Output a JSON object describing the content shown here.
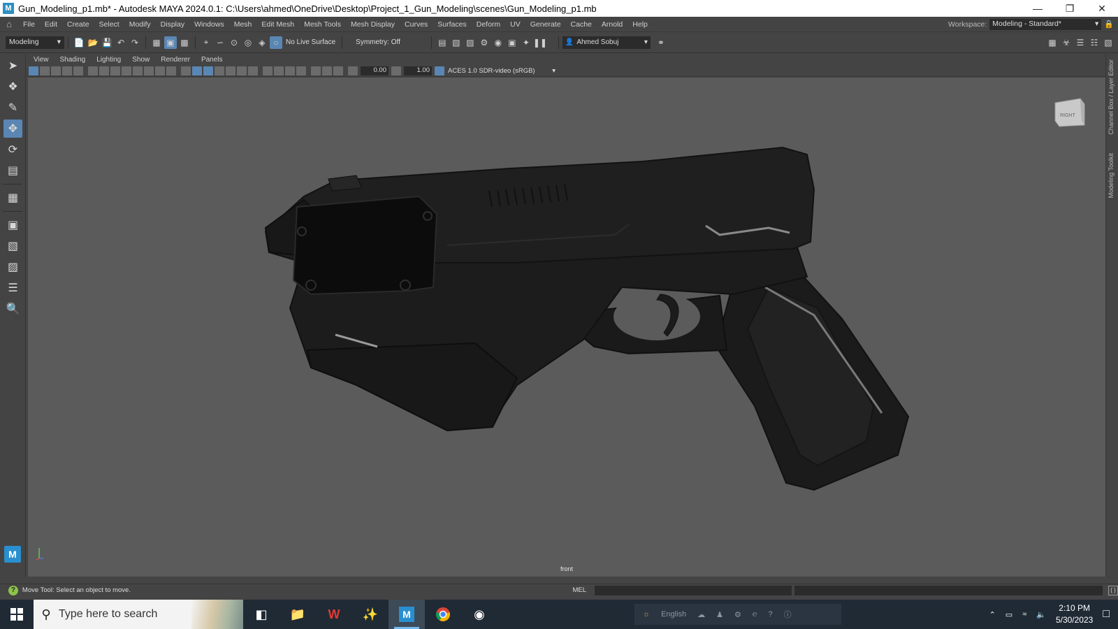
{
  "window": {
    "title": "Gun_Modeling_p1.mb* - Autodesk MAYA 2024.0.1: C:\\Users\\ahmed\\OneDrive\\Desktop\\Project_1_Gun_Modeling\\scenes\\Gun_Modeling_p1.mb",
    "controls": [
      "minimize",
      "restore",
      "close"
    ]
  },
  "menubar": {
    "items": [
      "File",
      "Edit",
      "Create",
      "Select",
      "Modify",
      "Display",
      "Windows",
      "Mesh",
      "Edit Mesh",
      "Mesh Tools",
      "Mesh Display",
      "Curves",
      "Surfaces",
      "Deform",
      "UV",
      "Generate",
      "Cache",
      "Arnold",
      "Help"
    ],
    "workspace_label": "Workspace:",
    "workspace_value": "Modeling - Standard*"
  },
  "statusline": {
    "mode": "Modeling",
    "live_surface": "No Live Surface",
    "symmetry": "Symmetry: Off",
    "user": "Ahmed Sobuj"
  },
  "panel": {
    "menu": [
      "View",
      "Shading",
      "Lighting",
      "Show",
      "Renderer",
      "Panels"
    ],
    "exposure": "0.00",
    "gamma": "1.00",
    "color_space": "ACES 1.0 SDR-video (sRGB)",
    "camera": "front",
    "viewcube_label": "RIGHT"
  },
  "right_tabs": [
    "Channel Box / Layer Editor",
    "Modeling Toolkit"
  ],
  "helpline": {
    "text": "Move Tool: Select an object to move.",
    "command_lang": "MEL"
  },
  "taskbar": {
    "search_placeholder": "Type here to search",
    "apps": [
      "task-view",
      "file-explorer",
      "wps-office",
      "zbrush",
      "maya",
      "chrome",
      "obs"
    ],
    "active_app": "maya",
    "tray_language": "English",
    "time": "2:10 PM",
    "date": "5/30/2023"
  },
  "colors": {
    "ui_bg": "#444444",
    "viewport_bg": "#5b5b5b",
    "accent": "#5a86b3",
    "taskbar": "#1f2a35"
  }
}
